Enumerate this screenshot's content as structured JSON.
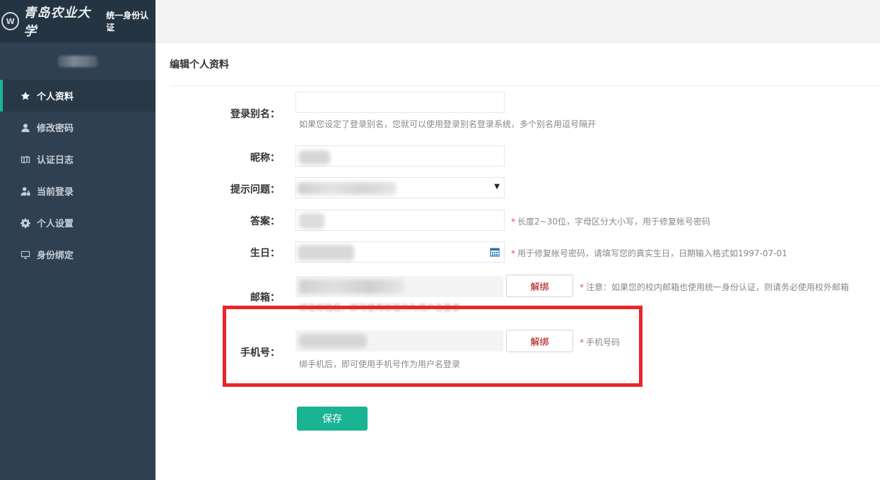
{
  "brand": {
    "logo_text": "W",
    "name": "青岛农业大学",
    "subtitle": "统一身份认证"
  },
  "sidebar": {
    "items": [
      {
        "label": "个人资料",
        "icon": "star-icon"
      },
      {
        "label": "修改密码",
        "icon": "user-icon"
      },
      {
        "label": "认证日志",
        "icon": "book-icon"
      },
      {
        "label": "当前登录",
        "icon": "user-lock-icon"
      },
      {
        "label": "个人设置",
        "icon": "gear-icon"
      },
      {
        "label": "身份绑定",
        "icon": "monitor-icon"
      }
    ],
    "active_index": 0
  },
  "panel": {
    "title": "编辑个人资料"
  },
  "form": {
    "alias": {
      "label": "登录别名：",
      "value": "",
      "help": "如果您设定了登录别名，您就可以使用登录别名登录系统，多个别名用逗号隔开"
    },
    "nickname": {
      "label": "昵称："
    },
    "question": {
      "label": "提示问题：",
      "arrow": "▼"
    },
    "answer": {
      "label": "答案：",
      "help": "长度2~30位，字母区分大小写，用于修复帐号密码"
    },
    "birthday": {
      "label": "生日：",
      "help": "用于修复帐号密码，请填写您的真实生日，日期输入格式如1997-07-01"
    },
    "email": {
      "label": "邮箱：",
      "unbind_label": "解绑",
      "help": "注意：如果您的校内邮箱也使用统一身份认证，则请务必使用校外邮箱",
      "subhelp": "绑定邮箱后，即可使用邮箱作为用户名登录"
    },
    "phone": {
      "label": "手机号：",
      "unbind_label": "解绑",
      "help": "手机号码",
      "subhelp": "绑手机后，即可使用手机号作为用户名登录"
    },
    "required_mark": "*",
    "save_label": "保存"
  },
  "colors": {
    "sidebar_bg": "#2f4050",
    "accent": "#1ab394",
    "highlight": "#e8262b",
    "required": "#d9534f"
  }
}
